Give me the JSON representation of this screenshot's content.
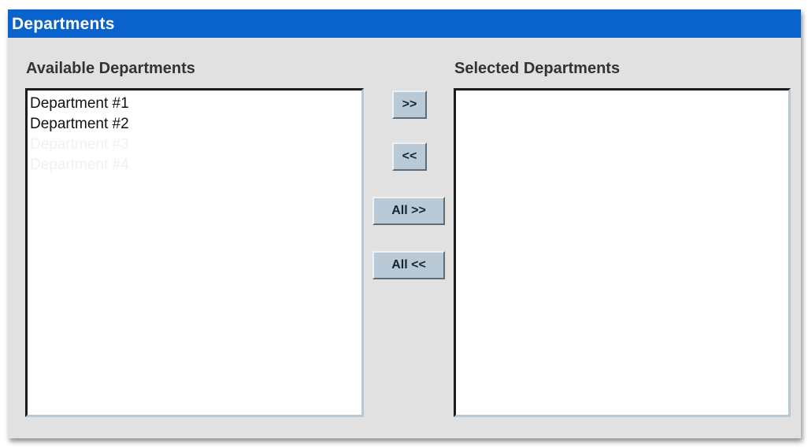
{
  "panel": {
    "title": "Departments"
  },
  "available": {
    "label": "Available Departments",
    "items": [
      "Department #1",
      "Department #2"
    ],
    "faded_items": [
      "Department #3",
      "Department #4"
    ]
  },
  "selected": {
    "label": "Selected Departments",
    "items": []
  },
  "buttons": {
    "add": ">>",
    "remove": "<<",
    "add_all": "All >>",
    "remove_all": "All <<"
  },
  "colors": {
    "title_bar": "#0a63cc",
    "panel_bg": "#e1e1e1",
    "button_bg": "#b9c9d5"
  }
}
